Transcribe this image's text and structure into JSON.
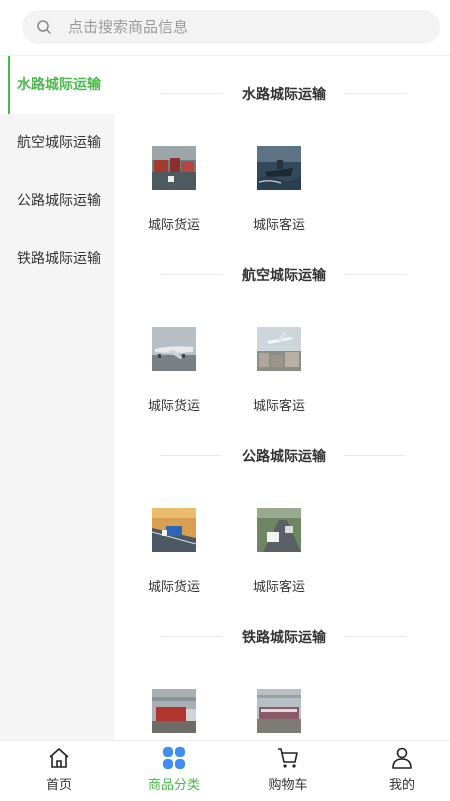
{
  "search": {
    "placeholder": "点击搜索商品信息"
  },
  "sidebar": {
    "items": [
      {
        "label": "水路城际运输",
        "active": true
      },
      {
        "label": "航空城际运输",
        "active": false
      },
      {
        "label": "公路城际运输",
        "active": false
      },
      {
        "label": "铁路城际运输",
        "active": false
      }
    ]
  },
  "sections": [
    {
      "title": "水路城际运输",
      "products": [
        {
          "label": "城际货运",
          "image": "cargo-ship-photo"
        },
        {
          "label": "城际客运",
          "image": "ship-at-sea-photo"
        }
      ]
    },
    {
      "title": "航空城际运输",
      "products": [
        {
          "label": "城际货运",
          "image": "cargo-plane-photo"
        },
        {
          "label": "城际客运",
          "image": "airport-plane-photo"
        }
      ]
    },
    {
      "title": "公路城际运输",
      "products": [
        {
          "label": "城际货运",
          "image": "highway-truck-photo"
        },
        {
          "label": "城际客运",
          "image": "highway-bus-photo"
        }
      ]
    },
    {
      "title": "铁路城际运输",
      "products": [
        {
          "label": "",
          "image": "freight-train-photo"
        },
        {
          "label": "",
          "image": "passenger-train-photo"
        }
      ]
    }
  ],
  "tabbar": {
    "items": [
      {
        "label": "首页",
        "icon": "home-icon",
        "active": false
      },
      {
        "label": "商品分类",
        "icon": "category-icon",
        "active": true
      },
      {
        "label": "购物车",
        "icon": "cart-icon",
        "active": false
      },
      {
        "label": "我的",
        "icon": "user-icon",
        "active": false
      }
    ]
  },
  "colors": {
    "accent": "#4cb84c",
    "sidebar_bg": "#f5f5f5",
    "search_bg": "#f3f3f3",
    "category_icon": "#3f8ef0"
  }
}
